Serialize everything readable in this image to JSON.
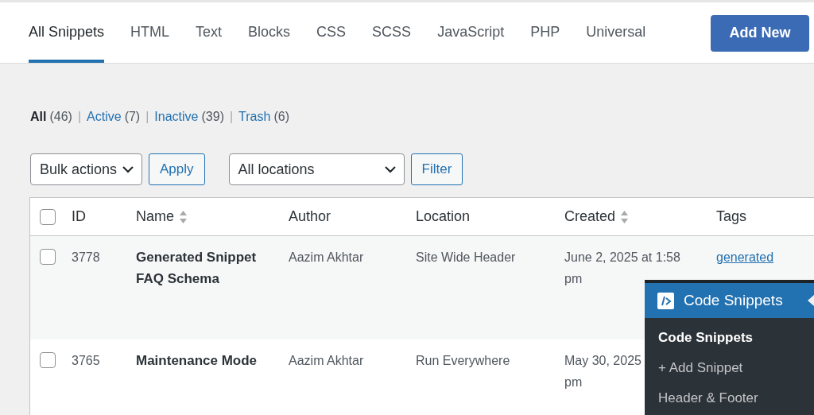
{
  "tabs": [
    {
      "label": "All Snippets",
      "selected": true
    },
    {
      "label": "HTML",
      "selected": false
    },
    {
      "label": "Text",
      "selected": false
    },
    {
      "label": "Blocks",
      "selected": false
    },
    {
      "label": "CSS",
      "selected": false
    },
    {
      "label": "SCSS",
      "selected": false
    },
    {
      "label": "JavaScript",
      "selected": false
    },
    {
      "label": "PHP",
      "selected": false
    },
    {
      "label": "Universal",
      "selected": false
    }
  ],
  "add_button": "Add New",
  "status_separator": "|",
  "status_filters": [
    {
      "label": "All",
      "count": "(46)",
      "selected": true
    },
    {
      "label": "Active",
      "count": "(7)",
      "selected": false
    },
    {
      "label": "Inactive",
      "count": "(39)",
      "selected": false
    },
    {
      "label": "Trash",
      "count": "(6)",
      "selected": false
    }
  ],
  "bulk_actions": {
    "value": "Bulk actions",
    "button": "Apply"
  },
  "locations": {
    "value": "All locations",
    "button": "Filter"
  },
  "table": {
    "select_all_checked": false,
    "columns": [
      {
        "label": "ID",
        "sortable": false
      },
      {
        "label": "Name",
        "sortable": true
      },
      {
        "label": "Author",
        "sortable": false
      },
      {
        "label": "Location",
        "sortable": false
      },
      {
        "label": "Created",
        "sortable": true
      },
      {
        "label": "Tags",
        "sortable": false
      }
    ],
    "rows": [
      {
        "checked": false,
        "id": "3778",
        "name": "Generated Snippet FAQ Schema",
        "author": "Aazim Akhtar",
        "location": "Site Wide Header",
        "created": [
          "June 2, 2025 at 1:58",
          "pm"
        ],
        "tags": [
          "generated"
        ]
      },
      {
        "checked": false,
        "id": "3765",
        "name": "Maintenance Mode",
        "author": "Aazim Akhtar",
        "location": "Run Everywhere",
        "created": [
          "May 30, 2025",
          "pm"
        ],
        "tags": []
      }
    ]
  },
  "flyout_menu": {
    "title": "Code Snippets",
    "items": [
      {
        "label": "Code Snippets",
        "selected": true
      },
      {
        "label": "+ Add Snippet",
        "selected": false
      },
      {
        "label": "Header & Footer",
        "selected": false
      }
    ]
  }
}
